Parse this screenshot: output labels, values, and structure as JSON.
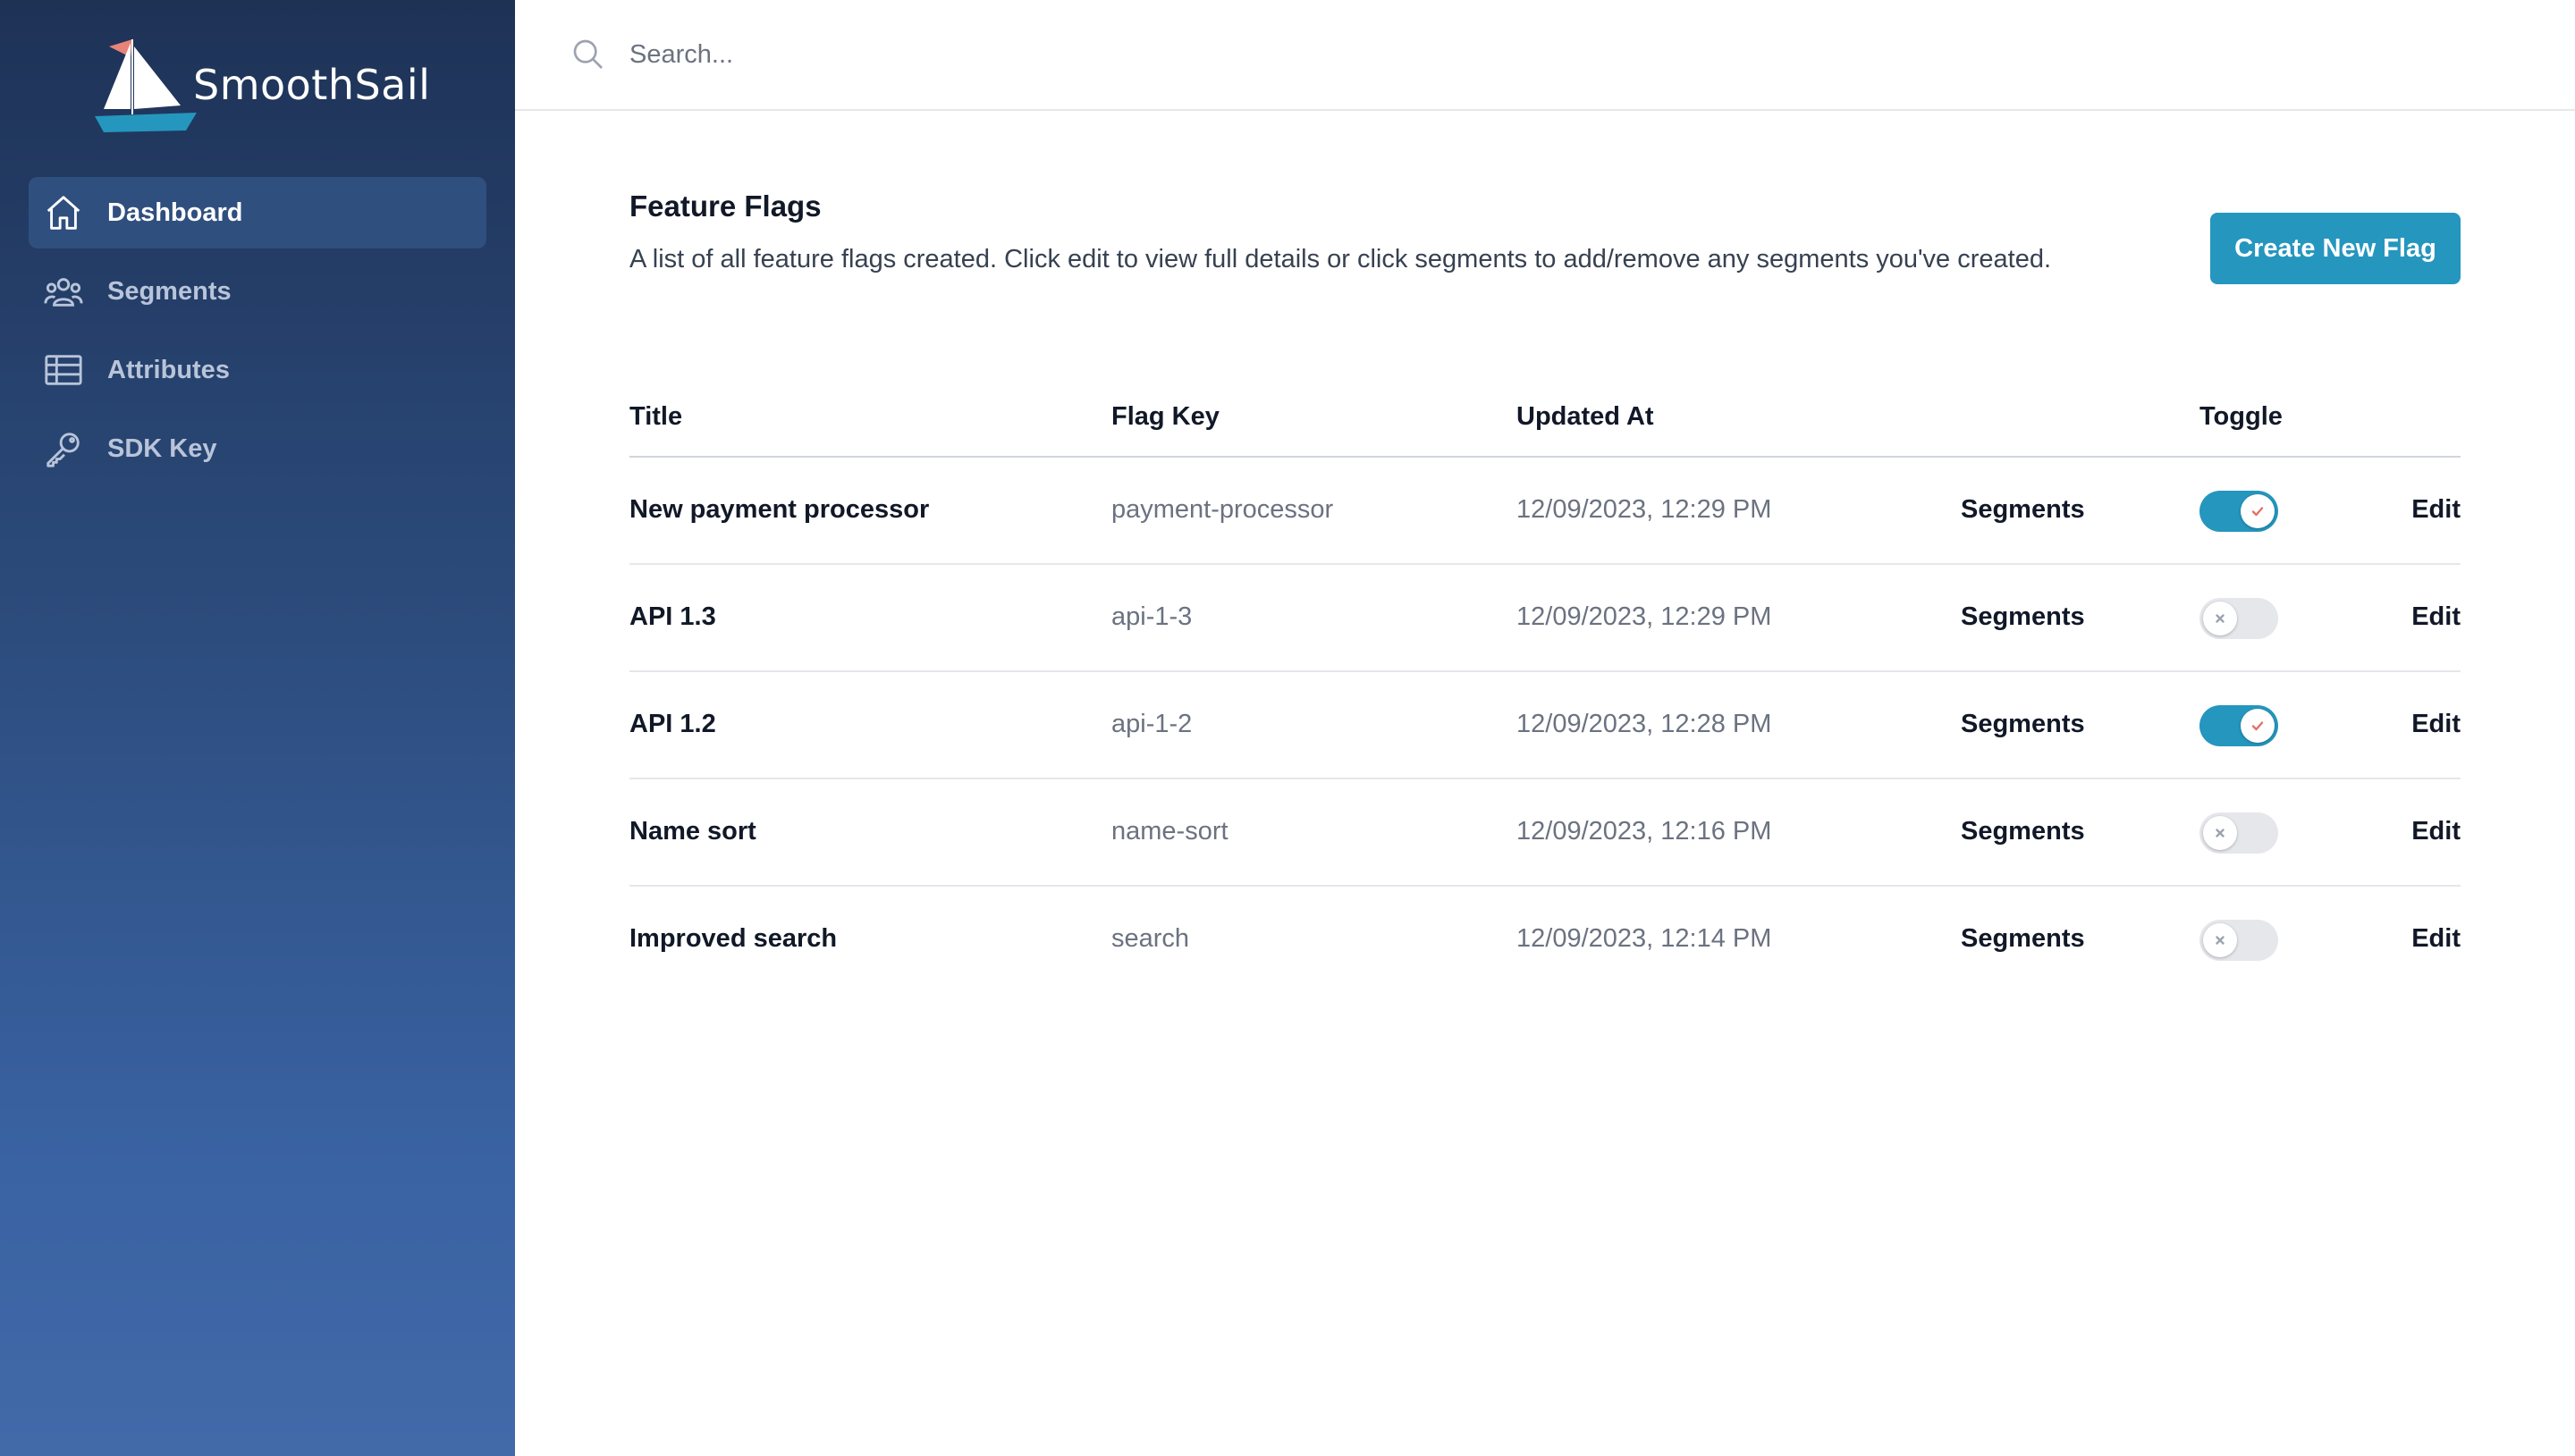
{
  "brand": {
    "name": "SmoothSail"
  },
  "sidebar": {
    "items": [
      {
        "label": "Dashboard",
        "icon": "home-icon",
        "active": true
      },
      {
        "label": "Segments",
        "icon": "users-icon",
        "active": false
      },
      {
        "label": "Attributes",
        "icon": "table-icon",
        "active": false
      },
      {
        "label": "SDK Key",
        "icon": "key-icon",
        "active": false
      }
    ]
  },
  "search": {
    "placeholder": "Search...",
    "value": ""
  },
  "main": {
    "title": "Feature Flags",
    "description": "A list of all feature flags created. Click edit to view full details or click segments to add/remove any segments you've created.",
    "create_label": "Create New Flag"
  },
  "table": {
    "headers": {
      "title": "Title",
      "key": "Flag Key",
      "updated": "Updated At",
      "toggle": "Toggle"
    },
    "rows": [
      {
        "title": "New payment processor",
        "key": "payment-processor",
        "updated": "12/09/2023, 12:29 PM",
        "segments": "Segments",
        "enabled": true,
        "edit": "Edit"
      },
      {
        "title": "API 1.3",
        "key": "api-1-3",
        "updated": "12/09/2023, 12:29 PM",
        "segments": "Segments",
        "enabled": false,
        "edit": "Edit"
      },
      {
        "title": "API 1.2",
        "key": "api-1-2",
        "updated": "12/09/2023, 12:28 PM",
        "segments": "Segments",
        "enabled": true,
        "edit": "Edit"
      },
      {
        "title": "Name sort",
        "key": "name-sort",
        "updated": "12/09/2023, 12:16 PM",
        "segments": "Segments",
        "enabled": false,
        "edit": "Edit"
      },
      {
        "title": "Improved search",
        "key": "search",
        "updated": "12/09/2023, 12:14 PM",
        "segments": "Segments",
        "enabled": false,
        "edit": "Edit"
      }
    ]
  },
  "colors": {
    "accent": "#2596be",
    "sidebar_top": "#1e3256",
    "sidebar_bottom": "#4269a8",
    "toggle_off": "#e5e7eb",
    "check": "#e0736a"
  }
}
